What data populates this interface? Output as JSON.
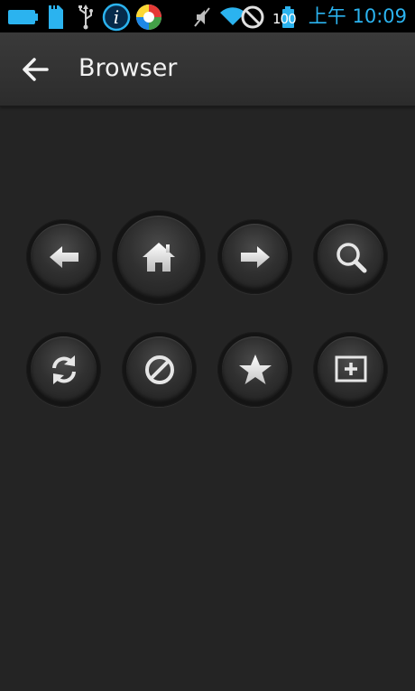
{
  "status_bar": {
    "time": "上午 10:09",
    "battery_level_label": "100",
    "icons": [
      "battery-full-icon",
      "sd-card-icon",
      "usb-icon",
      "info-icon",
      "app-circle-icon",
      "mute-icon",
      "wifi-icon",
      "blocked-icon",
      "battery-icon"
    ],
    "accent_color": "#2bb3ef"
  },
  "action_bar": {
    "title": "Browser",
    "back_icon": "arrow-left-icon"
  },
  "controls": {
    "row1": [
      {
        "name": "back-button",
        "icon": "arrow-left-icon"
      },
      {
        "name": "home-button",
        "icon": "home-icon"
      },
      {
        "name": "forward-button",
        "icon": "arrow-right-icon"
      },
      {
        "name": "search-button",
        "icon": "search-icon"
      }
    ],
    "row2": [
      {
        "name": "refresh-button",
        "icon": "refresh-icon"
      },
      {
        "name": "stop-button",
        "icon": "stop-icon"
      },
      {
        "name": "bookmark-button",
        "icon": "star-icon"
      },
      {
        "name": "new-tab-button",
        "icon": "add-tab-icon"
      }
    ]
  }
}
